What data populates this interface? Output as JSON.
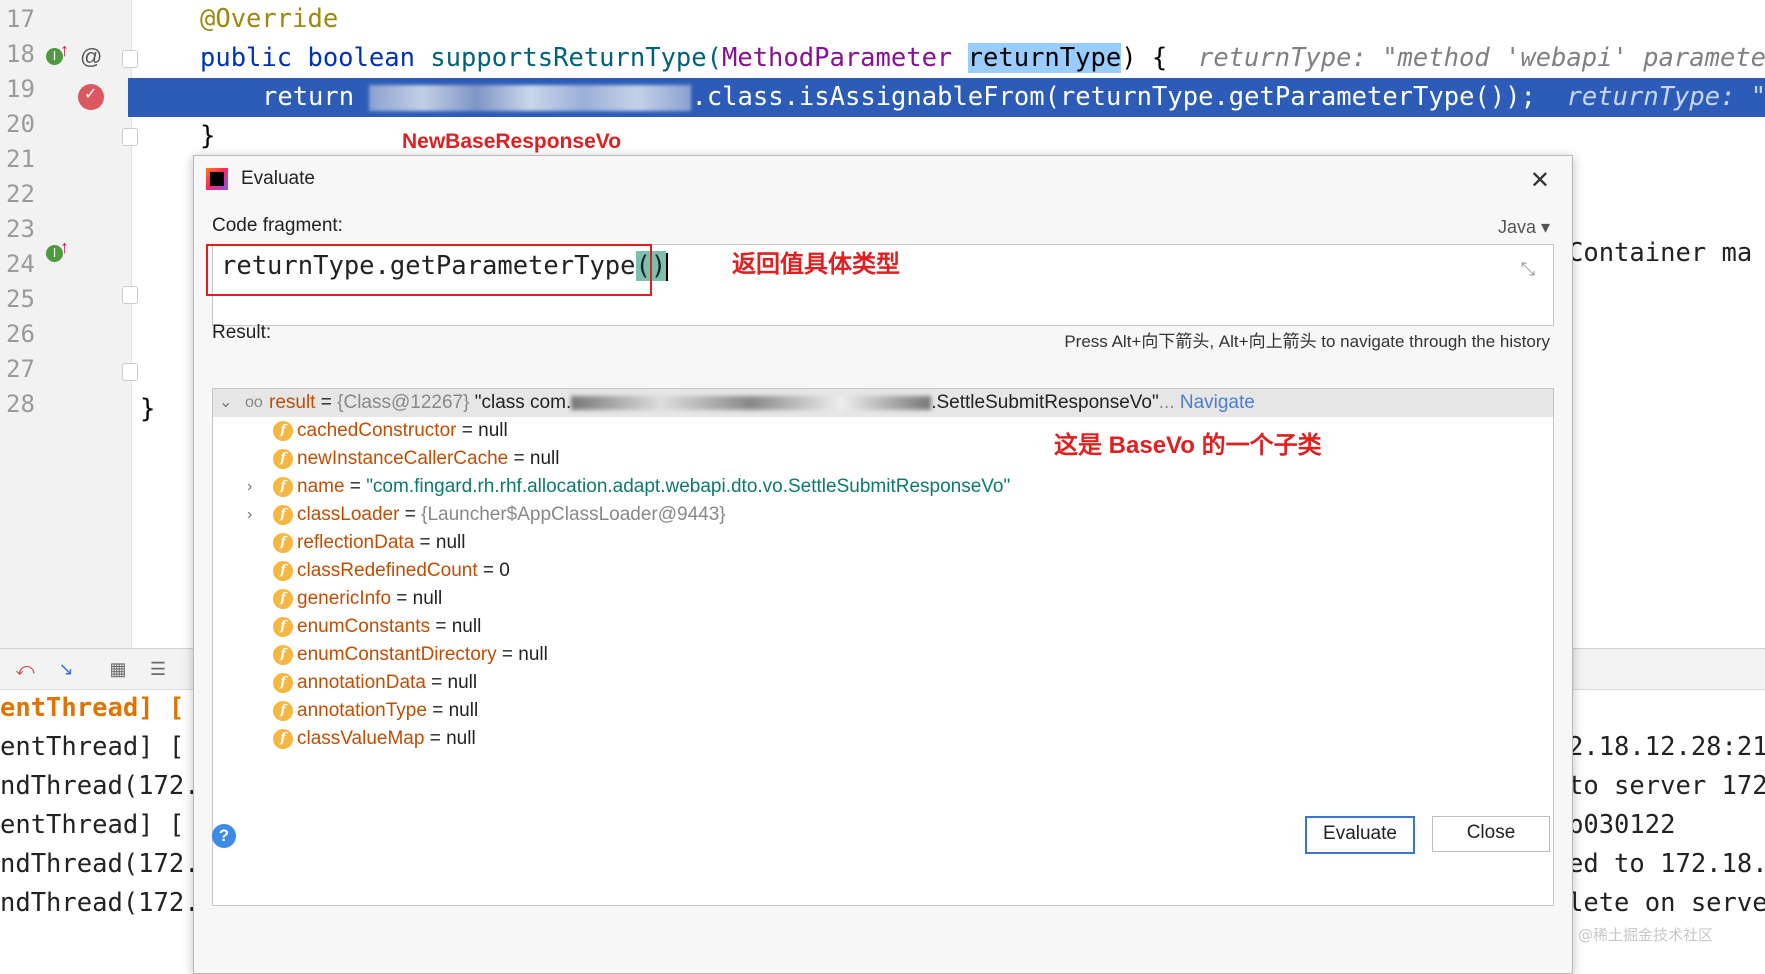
{
  "editor": {
    "line_numbers": [
      "17",
      "18",
      "19",
      "20",
      "21",
      "22",
      "23",
      "24",
      "25",
      "26",
      "27",
      "28"
    ],
    "lines": {
      "l17": "@Override",
      "l18_kw": "public boolean ",
      "l18_method": "supportsReturnType(",
      "l18_type": "MethodParameter",
      "l18_param": "returnType",
      "l18_end": ") {",
      "l18_hint": "returnType: \"method 'webapi' paramete",
      "l19_return": "return ",
      "l19_rest": ".class.isAssignableFrom(returnType.getParameterType());",
      "l19_hint": "returnType: \"m",
      "l20": "}",
      "l23_right": "Container ma",
      "l27": "}"
    },
    "annotation_red": "NewBaseResponseVo"
  },
  "console": {
    "left_lines": [
      "entThread] [",
      "entThread] [",
      "ndThread(172.",
      "entThread] [",
      "ndThread(172.",
      "ndThread(172."
    ],
    "right_lines": [
      "2.18.12.28:21",
      "to server 172",
      "b030122",
      "ed to 172.18.",
      "lete on serve"
    ],
    "watermark": "@稀土掘金技术社区"
  },
  "dialog": {
    "title": "Evaluate",
    "code_fragment_label": "Code fragment:",
    "language": "Java ▾",
    "code_main": "returnType.getParameterType",
    "code_parens": "()",
    "code_note": "返回值具体类型",
    "history_hint": "Press Alt+向下箭头, Alt+向上箭头 to navigate through the history",
    "result_label": "Result:",
    "result": {
      "name": "result",
      "eq": " = ",
      "ref": "{Class@12267}",
      "value_start": " \"class com.",
      "value_end": ".SettleSubmitResponseVo\"",
      "ellipsis": "...",
      "navigate": "Navigate"
    },
    "result_note": "这是 BaseVo 的一个子类",
    "fields": [
      {
        "name": "cachedConstructor",
        "value": "null"
      },
      {
        "name": "newInstanceCallerCache",
        "value": "null"
      },
      {
        "name": "name",
        "value": "\"com.fingard.rh.rhf.allocation.adapt.webapi.dto.vo.SettleSubmitResponseVo\""
      },
      {
        "name": "classLoader",
        "value": "{Launcher$AppClassLoader@9443}"
      },
      {
        "name": "reflectionData",
        "value": "null"
      },
      {
        "name": "classRedefinedCount",
        "value": "0"
      },
      {
        "name": "genericInfo",
        "value": "null"
      },
      {
        "name": "enumConstants",
        "value": "null"
      },
      {
        "name": "enumConstantDirectory",
        "value": "null"
      },
      {
        "name": "annotationData",
        "value": "null"
      },
      {
        "name": "annotationType",
        "value": "null"
      },
      {
        "name": "classValueMap",
        "value": "null"
      }
    ],
    "evaluate_button": "Evaluate",
    "close_button": "Close",
    "help_glyph": "?"
  }
}
